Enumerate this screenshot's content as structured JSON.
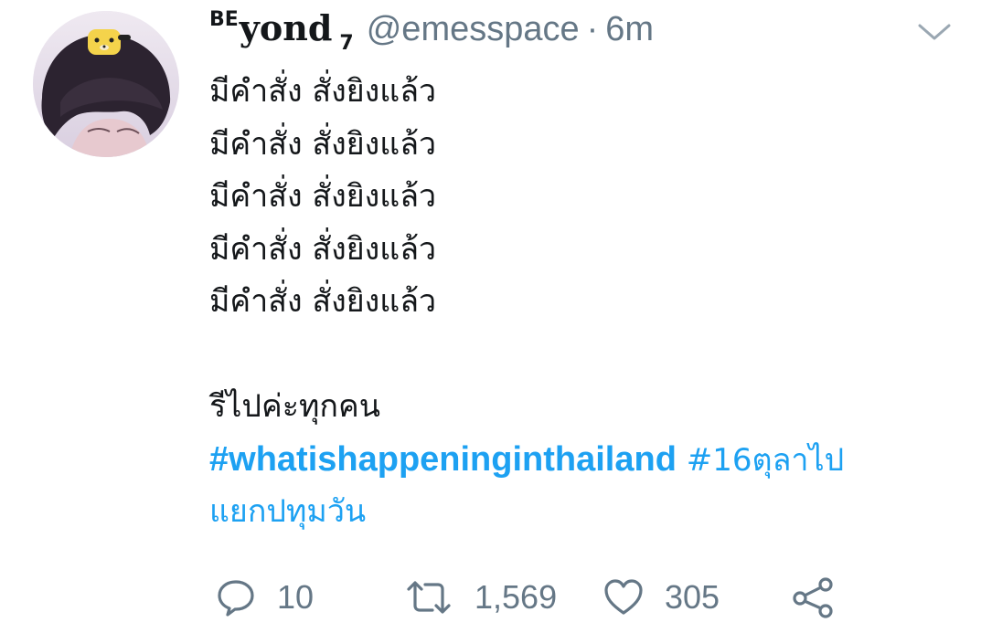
{
  "user": {
    "display_name_sup": "BE",
    "display_name_main": "yond",
    "display_name_sub": "7",
    "handle": "@emesspace",
    "separator": "·",
    "time": "6m"
  },
  "tweet": {
    "lines": [
      "มีคำสั่ง สั่งยิงแล้ว",
      "มีคำสั่ง สั่งยิงแล้ว",
      "มีคำสั่ง สั่งยิงแล้ว",
      "มีคำสั่ง สั่งยิงแล้ว",
      "มีคำสั่ง สั่งยิงแล้ว"
    ],
    "closing": "รีไปค่ะทุกคน",
    "hashtag_1": "#whatishappeninginthailand",
    "hashtag_2": "#16ตุลาไป",
    "hashtag_2_cont": "แยกปทุมวัน"
  },
  "actions": {
    "replies": "10",
    "retweets": "1,569",
    "likes": "305"
  },
  "colors": {
    "link": "#1da1f2",
    "secondary": "#657786",
    "text": "#14171a"
  },
  "icons": {
    "reply": "reply-icon",
    "retweet": "retweet-icon",
    "like": "heart-icon",
    "share": "share-icon",
    "menu": "chevron-down-icon"
  }
}
